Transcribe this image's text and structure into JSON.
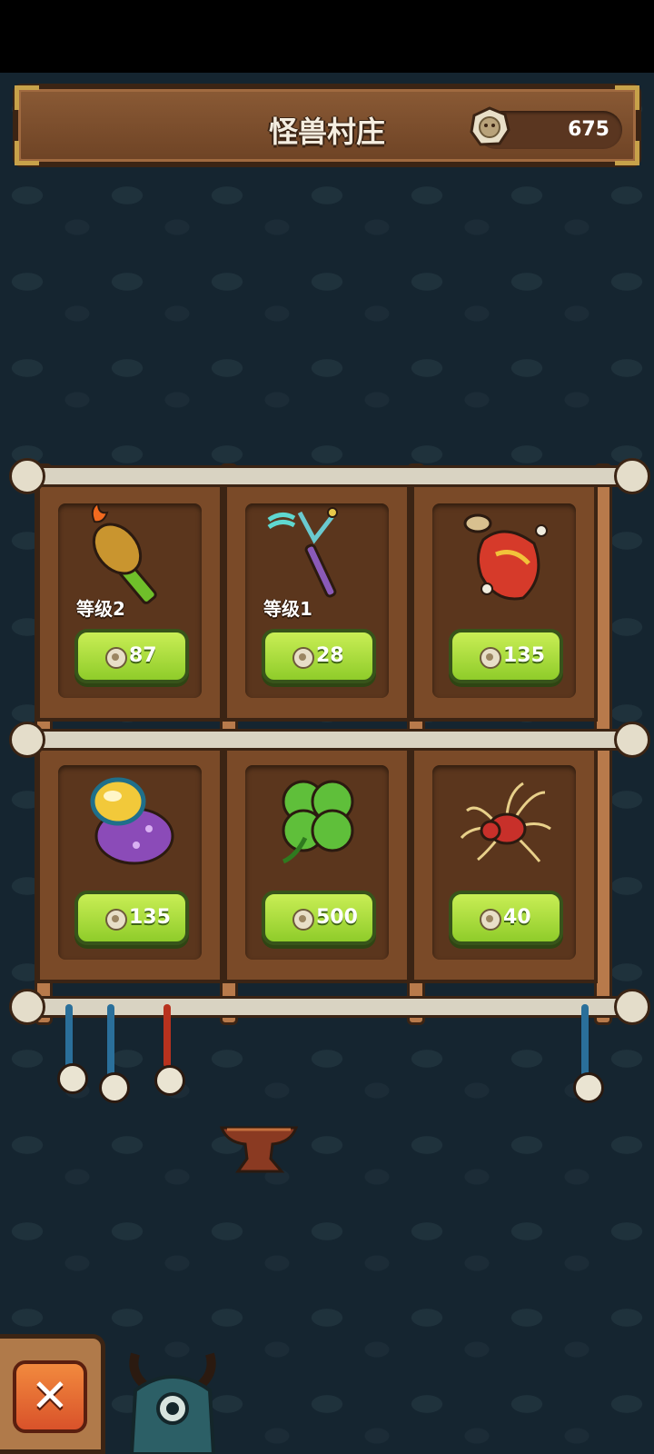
{
  "header": {
    "title": "怪兽村庄",
    "coins": "675"
  },
  "shop": {
    "items": [
      {
        "name": "fire-torch",
        "level": "等级2",
        "price": "87"
      },
      {
        "name": "trident-staff",
        "level": "等级1",
        "price": "28"
      },
      {
        "name": "red-potion-flask",
        "level": "",
        "price": "135"
      },
      {
        "name": "purple-egg-creature",
        "level": "",
        "price": "135"
      },
      {
        "name": "four-leaf-clover",
        "level": "",
        "price": "500"
      },
      {
        "name": "red-spider",
        "level": "",
        "price": "40"
      }
    ]
  },
  "close_button": {
    "label": "✕"
  },
  "colors": {
    "price_button": "#9bd532",
    "plank": "#7a4a28",
    "background": "#152530"
  }
}
